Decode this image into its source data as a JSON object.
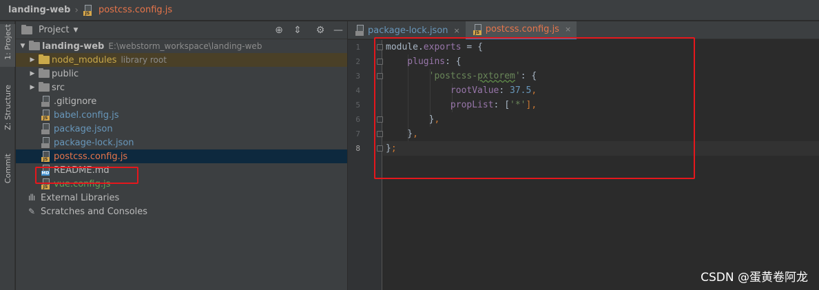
{
  "breadcrumb": {
    "project": "landing-web",
    "file": "postcss.config.js"
  },
  "toolstrip": {
    "tabs": [
      {
        "label": "1: Project"
      },
      {
        "label": "Z: Structure"
      },
      {
        "label": "Commit"
      }
    ]
  },
  "project_panel": {
    "title": "Project",
    "icons": [
      "locate-icon",
      "collapse-icon",
      "gear-icon",
      "minimize-icon"
    ],
    "root": {
      "name": "landing-web",
      "path": "E:\\webstorm_workspace\\landing-web"
    },
    "items": [
      {
        "name": "node_modules",
        "hint": "library root"
      },
      {
        "name": "public"
      },
      {
        "name": "src"
      },
      {
        "name": ".gitignore"
      },
      {
        "name": "babel.config.js"
      },
      {
        "name": "package.json"
      },
      {
        "name": "package-lock.json"
      },
      {
        "name": "postcss.config.js"
      },
      {
        "name": "README.md"
      },
      {
        "name": "vue.config.js"
      },
      {
        "name": "External Libraries"
      },
      {
        "name": "Scratches and Consoles"
      }
    ]
  },
  "editor": {
    "tabs": [
      {
        "label": "package-lock.json",
        "close": "×"
      },
      {
        "label": "postcss.config.js",
        "close": "×"
      }
    ],
    "line_numbers": [
      "1",
      "2",
      "3",
      "4",
      "5",
      "6",
      "7",
      "8"
    ],
    "code": {
      "l1": {
        "a": "module",
        "b": ".",
        "c": "exports",
        "d": " = {"
      },
      "l2": {
        "a": "    plugins",
        "b": ": {"
      },
      "l3": {
        "a": "        ",
        "q1": "'postcss-",
        "q2": "pxtorem",
        "q3": "'",
        "b": ": {"
      },
      "l4": {
        "a": "            rootValue",
        "b": ": ",
        "n": "37.5",
        "c": ","
      },
      "l5": {
        "a": "            propList",
        "b": ": [",
        "s": "'*'",
        "c": "],"
      },
      "l6": {
        "a": "        }",
        "c": ","
      },
      "l7": {
        "a": "    }",
        "c": ","
      },
      "l8": {
        "a": "}",
        "c": ";"
      }
    }
  },
  "watermark": "CSDN @蛋黄卷阿龙"
}
